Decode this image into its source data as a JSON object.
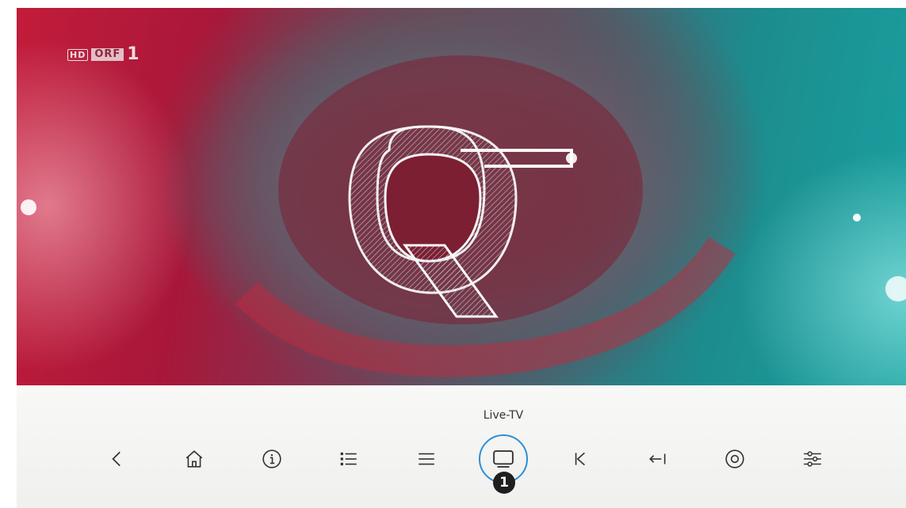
{
  "channel": {
    "hd": "HD",
    "name": "ORF",
    "number": "1"
  },
  "control_bar": {
    "focused_label": "Live-TV",
    "marker": "1",
    "buttons": [
      {
        "name": "back",
        "icon": "chevron-left-icon"
      },
      {
        "name": "home",
        "icon": "home-icon"
      },
      {
        "name": "info",
        "icon": "info-icon"
      },
      {
        "name": "channel-list",
        "icon": "bulleted-list-icon"
      },
      {
        "name": "menu",
        "icon": "hamburger-icon"
      },
      {
        "name": "live-tv",
        "icon": "tv-icon",
        "focused": true
      },
      {
        "name": "skip-back",
        "icon": "skip-back-icon"
      },
      {
        "name": "restart",
        "icon": "arrow-to-line-left-icon"
      },
      {
        "name": "record",
        "icon": "record-icon"
      },
      {
        "name": "settings",
        "icon": "sliders-icon"
      }
    ]
  },
  "colors": {
    "focus_ring": "#2b8fd8",
    "icon": "#333333",
    "bar_background": "#f4f4f2"
  }
}
